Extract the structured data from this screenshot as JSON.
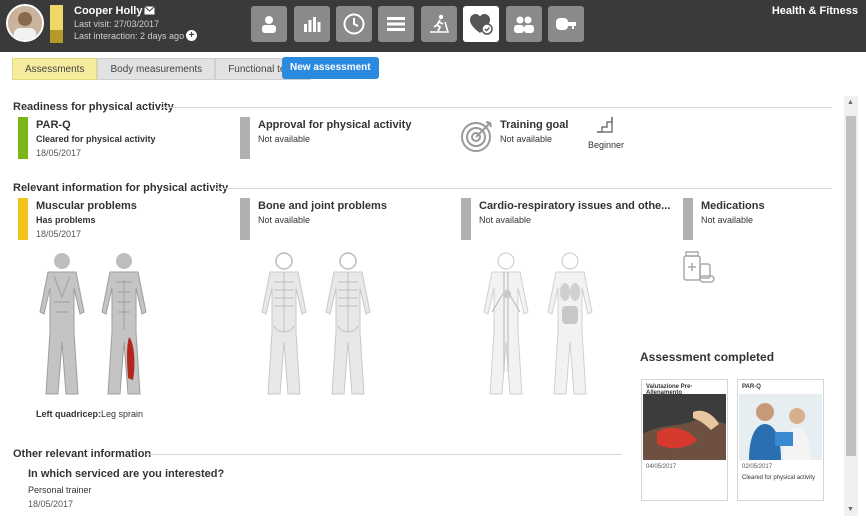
{
  "header": {
    "user_name": "Cooper Holly",
    "last_visit": "Last visit: 27/03/2017",
    "last_interaction": "Last interaction: 2 days ago",
    "app_title": "Health & Fitness",
    "nav_icons": [
      "person-icon",
      "bar-chart-icon",
      "clock-icon",
      "list-icon",
      "treadmill-icon",
      "heart-check-icon",
      "group-icon",
      "key-icon"
    ],
    "active_nav": "heart-check-icon"
  },
  "tabs": [
    {
      "label": "Assessments",
      "selected": true
    },
    {
      "label": "Body measurements",
      "selected": false
    },
    {
      "label": "Functional tests",
      "selected": false
    }
  ],
  "new_assessment_label": "New assessment",
  "readiness": {
    "heading": "Readiness for physical activity",
    "parq": {
      "title": "PAR-Q",
      "status": "Cleared for physical activity",
      "date": "18/05/2017",
      "color": "#7cb518"
    },
    "approval": {
      "title": "Approval for physical activity",
      "status": "Not available",
      "color": "#b0b0b0"
    },
    "training_goal": {
      "title": "Training goal",
      "status": "Not available",
      "level": "Beginner"
    }
  },
  "relevant": {
    "heading": "Relevant information for physical activity",
    "muscular": {
      "title": "Muscular problems",
      "status": "Has problems",
      "date": "18/05/2017",
      "color": "#f0c419",
      "note_label": "Left quadricep:",
      "note_value": "Leg sprain"
    },
    "bone": {
      "title": "Bone and joint problems",
      "status": "Not available",
      "color": "#b0b0b0"
    },
    "cardio": {
      "title": "Cardio-respiratory issues and othe...",
      "status": "Not available",
      "color": "#b0b0b0"
    },
    "medications": {
      "title": "Medications",
      "status": "Not available",
      "color": "#b0b0b0"
    }
  },
  "other": {
    "heading": "Other relevant information",
    "question": "In which serviced are you interested?",
    "answer": "Personal trainer",
    "date": "18/05/2017"
  },
  "completed": {
    "heading": "Assessment completed",
    "cards": [
      {
        "title": "Valutazione Pre-Allenamento",
        "date": "04/05/2017",
        "desc": ""
      },
      {
        "title": "PAR-Q",
        "date": "02/05/2017",
        "desc": "Cleared for physical activity"
      }
    ]
  },
  "colors": {
    "topbar": "#3a3a3a",
    "accent_blue": "#2a8ae0",
    "tab_selected": "#f5ec9d",
    "injury_red": "#b3261e"
  }
}
